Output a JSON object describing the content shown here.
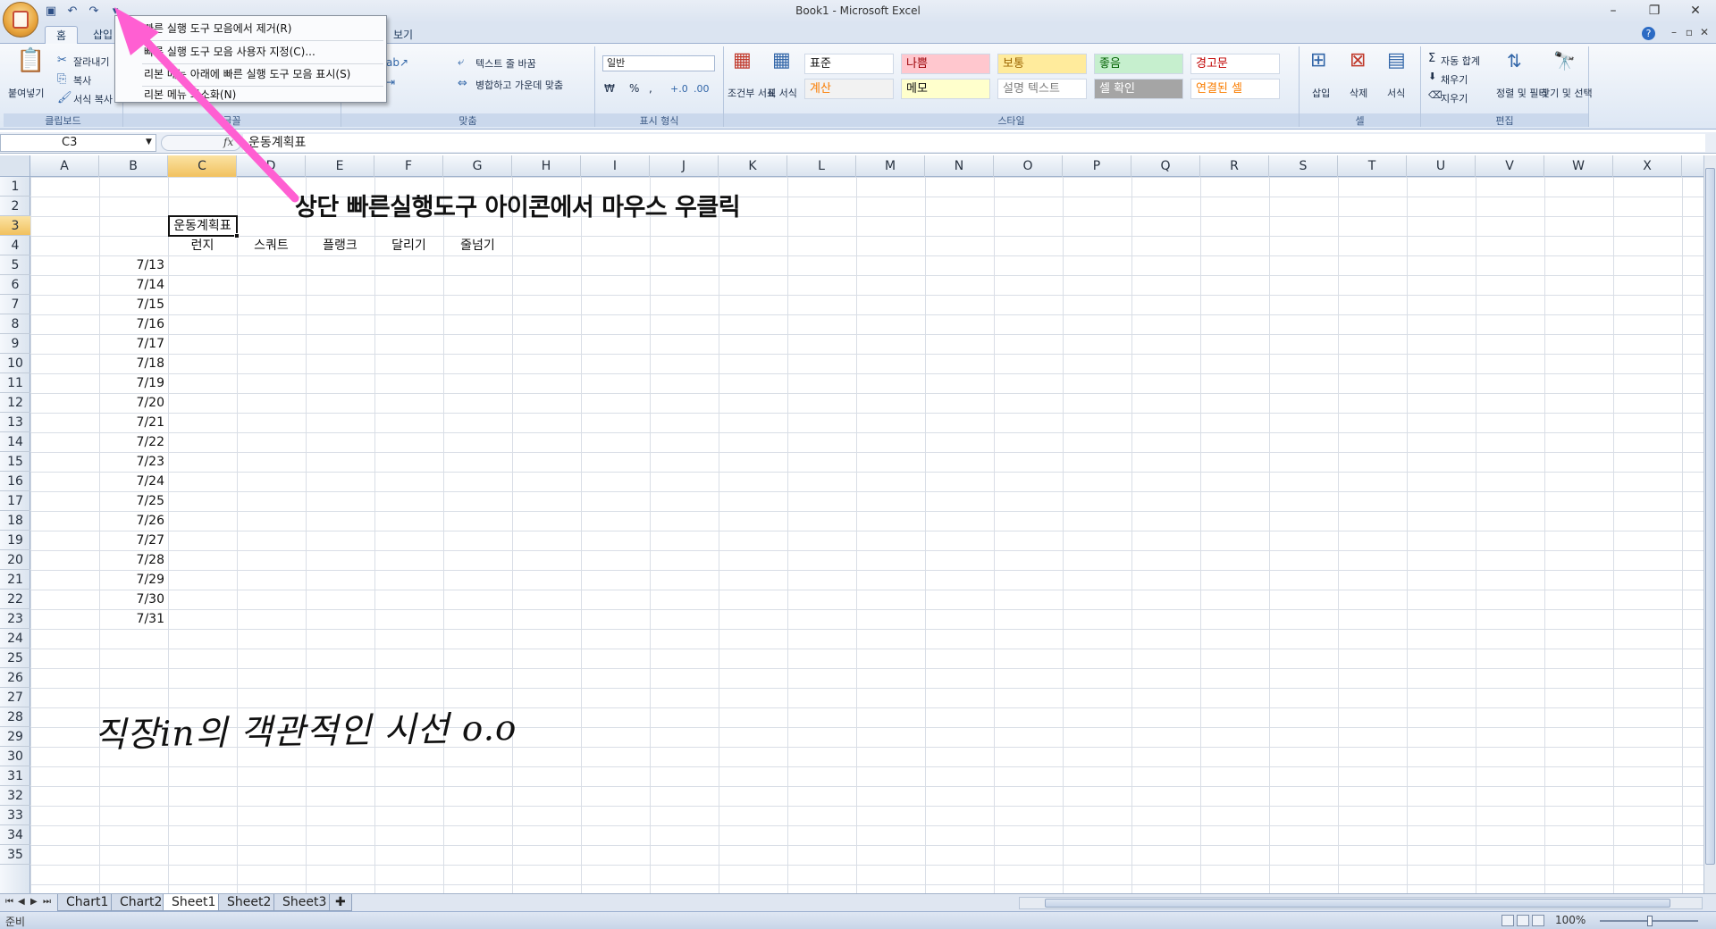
{
  "window": {
    "title": "Book1 - Microsoft Excel",
    "minimize": "–",
    "restore": "❐",
    "close": "✕"
  },
  "tabs": [
    "홈",
    "삽입",
    "보기"
  ],
  "context_menu": {
    "items": [
      "빠른 실행 도구 모음에서 제거(R)",
      "빠른 실행 도구 모음 사용자 지정(C)...",
      "리본 메뉴 아래에 빠른 실행 도구 모음 표시(S)",
      "리본 메뉴 최소화(N)"
    ]
  },
  "ribbon": {
    "clipboard": {
      "paste": "붙여넣기",
      "cut": "잘라내기",
      "copy": "복사",
      "format_painter": "서식 복사",
      "label": "클립보드"
    },
    "font": {
      "label": "글꼴"
    },
    "alignment": {
      "wrap_text": "텍스트 줄 바꿈",
      "merge_center": "병합하고 가운데 맞춤",
      "label": "맞춤"
    },
    "number": {
      "format": "일반",
      "currency": "₩",
      "percent": "%",
      "comma": ",",
      "label": "표시 형식"
    },
    "styles": {
      "conditional": "조건부 서식",
      "table": "표 서식",
      "cells": [
        {
          "name": "표준",
          "color": "#111111",
          "bg": "#ffffff"
        },
        {
          "name": "나쁨",
          "color": "#9c0006",
          "bg": "#ffc7ce"
        },
        {
          "name": "보통",
          "color": "#9c6500",
          "bg": "#ffeb9c"
        },
        {
          "name": "좋음",
          "color": "#006100",
          "bg": "#c6efce"
        },
        {
          "name": "경고문",
          "color": "#c00000",
          "bg": "#ffffff"
        },
        {
          "name": "계산",
          "color": "#fa7d00",
          "bg": "#f2f2f2"
        },
        {
          "name": "메모",
          "color": "#111111",
          "bg": "#ffffcc"
        },
        {
          "name": "설명 텍스트",
          "color": "#7f7f7f",
          "bg": "#ffffff"
        },
        {
          "name": "셀 확인",
          "color": "#ffffff",
          "bg": "#a5a5a5"
        },
        {
          "name": "연결된 셀",
          "color": "#fa7d00",
          "bg": "#ffffff"
        }
      ],
      "label": "스타일"
    },
    "cells": {
      "insert": "삽입",
      "delete": "삭제",
      "format": "서식",
      "label": "셀"
    },
    "editing": {
      "autosum": "자동 합계",
      "fill": "채우기",
      "clear": "지우기",
      "sort_filter": "정렬 및 필터",
      "find_select": "찾기 및 선택",
      "label": "편집"
    }
  },
  "formula_bar": {
    "name_box": "C3",
    "fx": "fx",
    "content": "운동계획표"
  },
  "columns": [
    "A",
    "B",
    "C",
    "D",
    "E",
    "F",
    "G",
    "H",
    "I",
    "J",
    "K",
    "L",
    "M",
    "N",
    "O",
    "P",
    "Q",
    "R",
    "S",
    "T",
    "U",
    "V",
    "W",
    "X"
  ],
  "rows": [
    "1",
    "2",
    "3",
    "4",
    "5",
    "6",
    "7",
    "8",
    "9",
    "10",
    "11",
    "12",
    "13",
    "14",
    "15",
    "16",
    "17",
    "18",
    "19",
    "20",
    "21",
    "22",
    "23",
    "24",
    "25",
    "26",
    "27",
    "28",
    "29",
    "30",
    "31",
    "32",
    "33",
    "34",
    "35"
  ],
  "selected": {
    "column": "C",
    "row": "3"
  },
  "cells": {
    "C3": "운동계획표",
    "headers": [
      "런지",
      "스쿼트",
      "플랭크",
      "달리기",
      "줄넘기"
    ],
    "dates": [
      "7/13",
      "7/14",
      "7/15",
      "7/16",
      "7/17",
      "7/18",
      "7/19",
      "7/20",
      "7/21",
      "7/22",
      "7/23",
      "7/24",
      "7/25",
      "7/26",
      "7/27",
      "7/28",
      "7/29",
      "7/30",
      "7/31"
    ]
  },
  "annotation": "상단 빠른실행도구 아이콘에서 마우스 우클릭",
  "watermark": "직장in의 객관적인 시선 o.o",
  "sheets": [
    "Chart1",
    "Chart2",
    "Sheet1",
    "Sheet2",
    "Sheet3"
  ],
  "active_sheet": "Sheet1",
  "status": {
    "text": "준비",
    "zoom": "100%"
  },
  "colors": {
    "arrow": "#ff5fd2",
    "selection_header": "#f1c15f"
  }
}
